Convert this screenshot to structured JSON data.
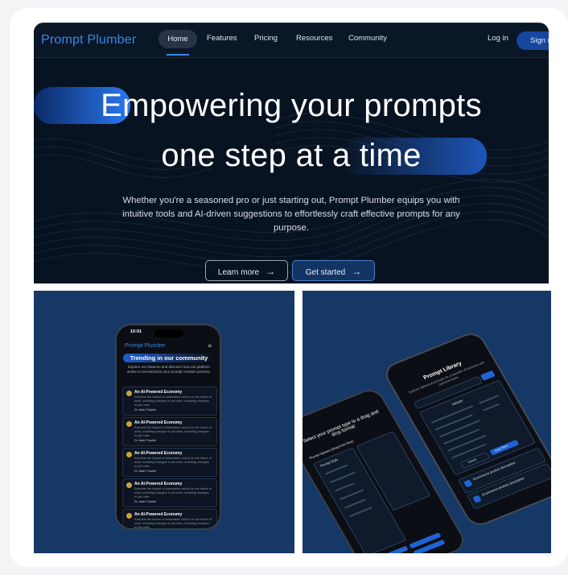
{
  "brand": {
    "name": "Prompt Plumber",
    "accent": "#3d86e8",
    "hero_bg": "#081321",
    "panel_bg": "#163866"
  },
  "nav": {
    "home": "Home",
    "features": "Features",
    "pricing": "Pricing",
    "resources": "Resources",
    "community": "Community",
    "login": "Log in",
    "signup": "Sign u"
  },
  "hero": {
    "headline_line1": "Empowering your prompts",
    "headline_line2": "one step at a time",
    "subtext": "Whether you're a seasoned pro or just starting out, Prompt Plumber equips you with intuitive tools and AI-driven suggestions to effortlessly craft effective prompts for any purpose.",
    "learn_more": "Learn more",
    "get_started": "Get started"
  },
  "phone1": {
    "time": "10:01",
    "logo": "Prompt Plumber",
    "menu_icon": "hamburger-icon",
    "heading": "Trending in our community",
    "description": "Explore our features and discover how our platform works to revolutionize your prompt creation process.",
    "items": [
      {
        "title": "An AI-Powered Economy",
        "body": "Examine the impact of automation and AI on the future of work, including changes to job roles, including changes to job roles.",
        "author": "Dr. Alan Futurist"
      },
      {
        "title": "An AI-Powered Economy",
        "body": "Examine the impact of automation and AI on the future of work, including changes to job roles, including changes to job roles.",
        "author": "Dr. Alan Futurist"
      },
      {
        "title": "An AI-Powered Economy",
        "body": "Examine the impact of automation and AI on the future of work, including changes to job roles, including changes to job roles.",
        "author": "Dr. Alan Futurist"
      },
      {
        "title": "An AI-Powered Economy",
        "body": "Examine the impact of automation and AI on the future of work, including changes to job roles, including changes to job roles.",
        "author": "Dr. Alan Futurist"
      },
      {
        "title": "An AI-Powered Economy",
        "body": "Examine the impact of automation and AI on the future of work, including changes to job roles, including changes to job roles.",
        "author": "Dr. Alan Futurist"
      }
    ]
  },
  "phone_back": {
    "title": "Select your prompt type to a drag and drop format",
    "label1": "Prompt Options (Drag from here)",
    "label2": "Prompt Style"
  },
  "phone_front": {
    "title": "Prompt Library",
    "subtitle": "Explore optimized prompts for a breadth of functions and personal tasks",
    "filter_label": "Industry",
    "card_title": "Ecommerce product description",
    "cancel": "Cancel",
    "apply": "Apply filters"
  }
}
